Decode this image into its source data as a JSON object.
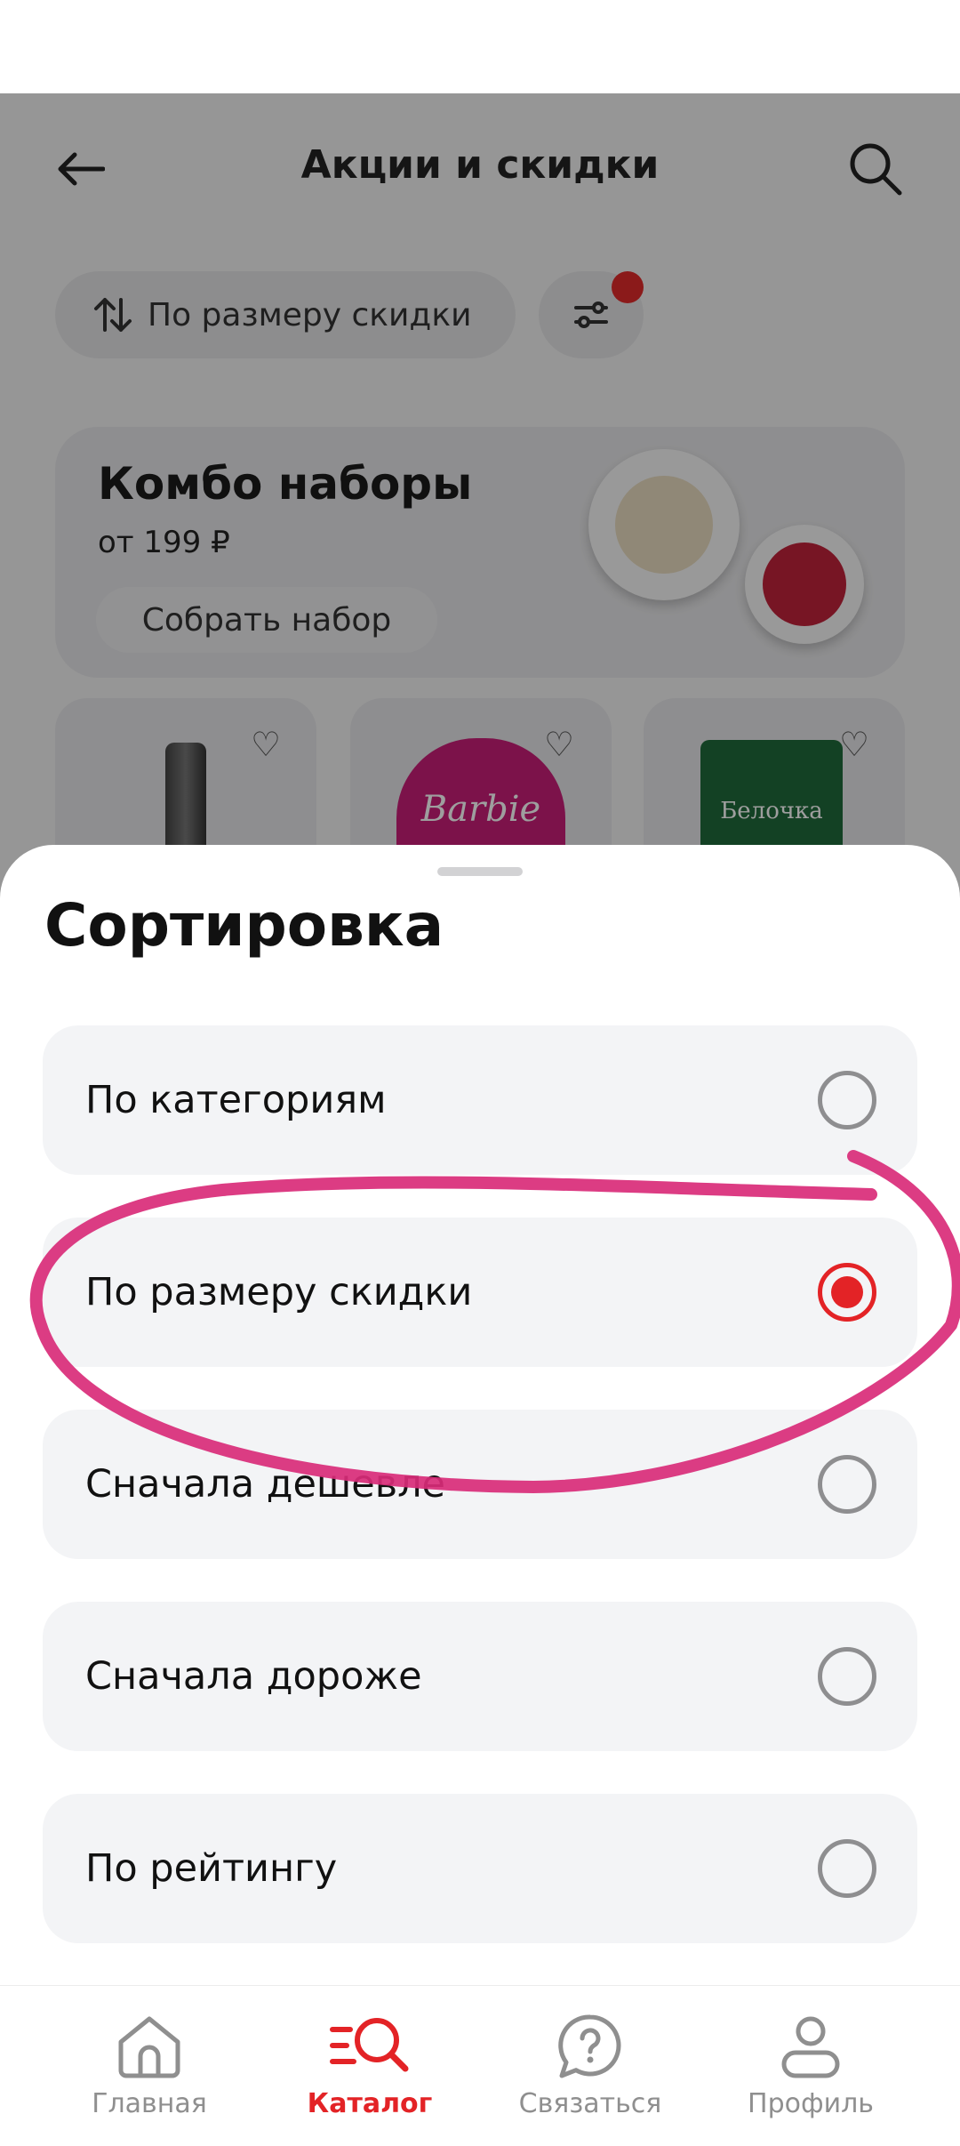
{
  "header": {
    "title": "Акции и скидки",
    "back_icon": "arrow-left-icon",
    "search_icon": "search-icon"
  },
  "toolbar": {
    "sort_label": "По размеру скидки",
    "sort_icon": "sort-arrows-icon",
    "filter_icon": "filter-sliders-icon",
    "filter_badge_color": "#e02a2a"
  },
  "promo": {
    "title": "Комбо наборы",
    "price": "от 199 ₽",
    "button_label": "Собрать набор"
  },
  "products": [
    {
      "image": "thermos",
      "heart_icon": "heart-outline-icon"
    },
    {
      "image": "barbie-toy",
      "image_text": "Barbie",
      "heart_icon": "heart-outline-icon"
    },
    {
      "image": "candy-bag",
      "image_text": "Белочка",
      "heart_icon": "heart-outline-icon"
    }
  ],
  "sheet": {
    "title": "Сортировка",
    "options": [
      {
        "label": "По категориям",
        "selected": false
      },
      {
        "label": "По размеру скидки",
        "selected": true
      },
      {
        "label": "Сначала дешевле",
        "selected": false
      },
      {
        "label": "Сначала дороже",
        "selected": false
      },
      {
        "label": "По рейтингу",
        "selected": false
      }
    ]
  },
  "nav": {
    "items": [
      {
        "label": "Главная",
        "icon": "home-icon",
        "active": false
      },
      {
        "label": "Каталог",
        "icon": "catalog-search-icon",
        "active": true
      },
      {
        "label": "Связаться",
        "icon": "question-chat-icon",
        "active": false
      },
      {
        "label": "Профиль",
        "icon": "user-icon",
        "active": false
      }
    ]
  },
  "colors": {
    "accent": "#e32326",
    "annotation": "#d92b78",
    "sheet_option_bg": "#f3f4f6"
  }
}
